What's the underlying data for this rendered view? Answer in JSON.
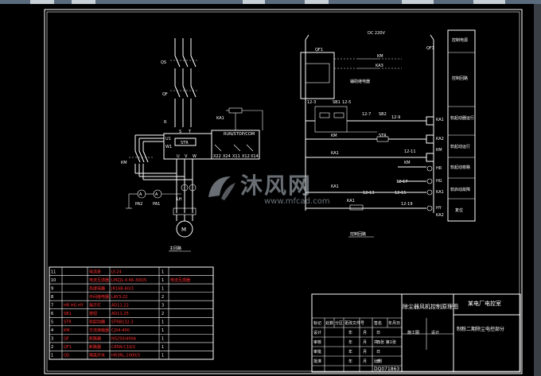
{
  "colors": {
    "background": "#000000",
    "line": "#ffffff",
    "table_red": "#ff3030",
    "accent_yellow": "#ffff00"
  },
  "main_circuit": {
    "qs": "QS",
    "qf": "QF",
    "km": "KM",
    "r": "R",
    "s": "S",
    "t": "T",
    "u1": "U1",
    "w1": "W1",
    "str": "STR",
    "u": "U",
    "v": "V",
    "w": "W",
    "u2": "U2",
    "v2": "V2",
    "w2": "W2",
    "ka1": "KA1",
    "run_stop": "RUN/STOP/COM",
    "x22": "X22",
    "x24": "X24",
    "x11": "X11",
    "x12": "X12",
    "x14": "X14",
    "pa2": "PA2",
    "pa1": "PA1",
    "lh": "LH",
    "motor": "M",
    "caption": "主回路"
  },
  "control_circuit": {
    "voltage": "DC 220V",
    "qf1_left": "QF1",
    "qf1_right": "QF1",
    "km": "KM",
    "ka3": "KA3",
    "caption_relay": "辅助继电器",
    "n12_3": "12-3",
    "n12_5": "12-5",
    "n12_7": "12-7",
    "n12_9": "12-9",
    "sb1": "SB1",
    "sb2": "SB2",
    "str": "STR",
    "ka1_coil": "KA1",
    "km_label": "KM",
    "km_coil": "KM",
    "ka2_coil": "KA2",
    "ka1_b": "KA1",
    "n12_11": "12-11",
    "n12_13": "12-13",
    "n12_15": "12-15",
    "n12_17": "12-17",
    "n12_19": "12-19",
    "km_b": "KM",
    "ka1_c": "KA1",
    "kar": "KA1",
    "hr": "HR",
    "hg": "HG",
    "ka1_d": "KA1",
    "hy": "HY",
    "ka2_d": "KA2",
    "caption": "控制回路"
  },
  "right_labels": [
    "控制电源",
    "控制回路",
    "软起动器运行",
    "软起动运行",
    "软起动旁路",
    "软启动故障",
    "复位"
  ],
  "bom": {
    "rows": [
      [
        "11",
        "",
        "电流表",
        "LY-24",
        "1",
        ""
      ],
      [
        "10",
        "",
        "电流互感器",
        "LMZJ1-0.66-300/5",
        "1",
        "电流互感器"
      ],
      [
        "9",
        "",
        "热继电器",
        "JR16B-60/3",
        "1",
        ""
      ],
      [
        "8",
        "",
        "中间继电器",
        "LAY3-22",
        "2",
        ""
      ],
      [
        "7",
        "HR HG HY",
        "指示灯",
        "AD11-22",
        "3",
        ""
      ],
      [
        "6",
        "SB1",
        "按钮",
        "AD11-25",
        "2",
        ""
      ],
      [
        "5",
        "STR",
        "软起动器",
        "STRB132-3",
        "1",
        ""
      ],
      [
        "4",
        "KM",
        "交流接触器",
        "CJX4-400",
        "1",
        ""
      ],
      [
        "3",
        "QF",
        "断路器",
        "NS250/400A",
        "1",
        ""
      ],
      [
        "2",
        "QF1",
        "断路器",
        "C65N-C10/2",
        "1",
        ""
      ],
      [
        "1",
        "QS",
        "隔离开关",
        "HR3RL-1000/3",
        "1",
        ""
      ]
    ]
  },
  "title_block": {
    "project": "除尘器风机控制原理图",
    "company": "某电厂电控室",
    "design_phase": "施工图",
    "design": "设计",
    "drawing_title": "制粉二期除尘电控部分",
    "row1": [
      "标记",
      "处数",
      "分区",
      "更改文件号",
      "签名",
      "年月日"
    ],
    "r2": [
      "设计",
      "",
      "年",
      "月",
      "日"
    ],
    "r3": [
      "审核",
      "",
      "年",
      "月",
      "日"
    ],
    "r4": [
      "审批",
      "",
      "年",
      "月",
      "日"
    ],
    "r5": [
      "批准",
      "",
      "年",
      "月",
      "日"
    ],
    "sheet": "共1张 第1张",
    "scale": "比例",
    "drawing_no": "DQ071863"
  },
  "watermark": {
    "text": "沐风网",
    "url": "www.mfcad.com"
  }
}
